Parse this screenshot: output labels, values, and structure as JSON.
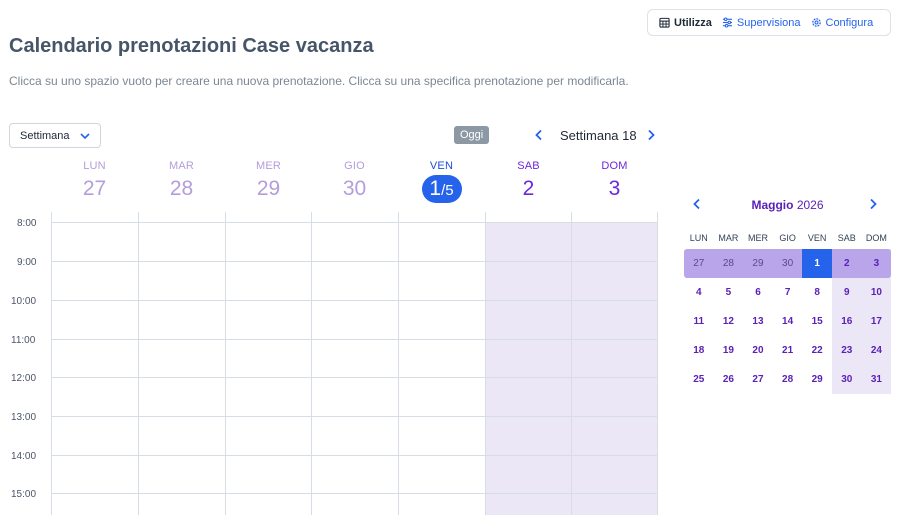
{
  "modes": [
    {
      "label": "Utilizza",
      "icon": "calendar-grid-icon",
      "active": true
    },
    {
      "label": "Supervisiona",
      "icon": "sliders-icon",
      "active": false
    },
    {
      "label": "Configura",
      "icon": "gear-icon",
      "active": false
    }
  ],
  "page": {
    "title": "Calendario prenotazioni Case vacanza",
    "subtitle": "Clicca su uno spazio vuoto per creare una nuova prenotazione. Clicca su una specifica prenotazione per modificarla."
  },
  "toolbar": {
    "view_value": "Settimana",
    "today_label": "Oggi",
    "week_label": "Settimana 18"
  },
  "week": {
    "days": [
      {
        "name": "LUN",
        "num": "27"
      },
      {
        "name": "MAR",
        "num": "28"
      },
      {
        "name": "MER",
        "num": "29"
      },
      {
        "name": "GIO",
        "num": "30"
      },
      {
        "name": "VEN",
        "num": "1",
        "month_suffix": "/5"
      },
      {
        "name": "SAB",
        "num": "2"
      },
      {
        "name": "DOM",
        "num": "3"
      }
    ],
    "times": [
      "8:00",
      "9:00",
      "10:00",
      "11:00",
      "12:00",
      "13:00",
      "14:00",
      "15:00"
    ]
  },
  "mini_calendar": {
    "month": "Maggio",
    "year": "2026",
    "dow": [
      "LUN",
      "MAR",
      "MER",
      "GIO",
      "VEN",
      "SAB",
      "DOM"
    ],
    "weeks": [
      [
        "27",
        "28",
        "29",
        "30",
        "1",
        "2",
        "3"
      ],
      [
        "4",
        "5",
        "6",
        "7",
        "8",
        "9",
        "10"
      ],
      [
        "11",
        "12",
        "13",
        "14",
        "15",
        "16",
        "17"
      ],
      [
        "18",
        "19",
        "20",
        "21",
        "22",
        "23",
        "24"
      ],
      [
        "25",
        "26",
        "27",
        "28",
        "29",
        "30",
        "31"
      ]
    ]
  },
  "colors": {
    "accent": "#2563eb",
    "purple": "#6d28d9",
    "weekend_bg": "#ebe7f6"
  }
}
